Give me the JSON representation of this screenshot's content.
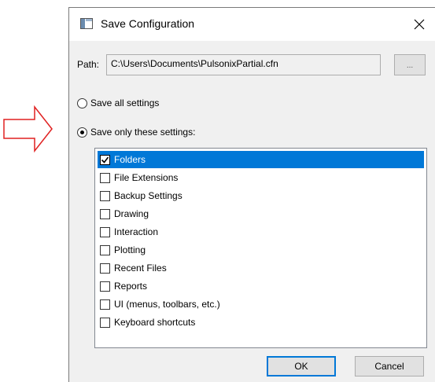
{
  "window": {
    "title": "Save Configuration"
  },
  "path": {
    "label": "Path:",
    "value": "C:\\Users\\Documents\\PulsonixPartial.cfn",
    "browse_label": "..."
  },
  "options": {
    "save_all": "Save all settings",
    "save_only": "Save only these settings:",
    "selected": "save_only"
  },
  "settings": [
    {
      "label": "Folders",
      "checked": true,
      "selected": true
    },
    {
      "label": "File Extensions",
      "checked": false
    },
    {
      "label": "Backup Settings",
      "checked": false
    },
    {
      "label": "Drawing",
      "checked": false
    },
    {
      "label": "Interaction",
      "checked": false
    },
    {
      "label": "Plotting",
      "checked": false
    },
    {
      "label": "Recent Files",
      "checked": false
    },
    {
      "label": "Reports",
      "checked": false
    },
    {
      "label": "UI (menus, toolbars, etc.)",
      "checked": false
    },
    {
      "label": "Keyboard shortcuts",
      "checked": false
    }
  ],
  "buttons": {
    "ok": "OK",
    "cancel": "Cancel"
  },
  "colors": {
    "selection": "#0078d7",
    "annotation": "#e02020"
  },
  "icons": {
    "annotation": "arrow-right-icon",
    "window": "window-icon",
    "close": "close-icon"
  }
}
